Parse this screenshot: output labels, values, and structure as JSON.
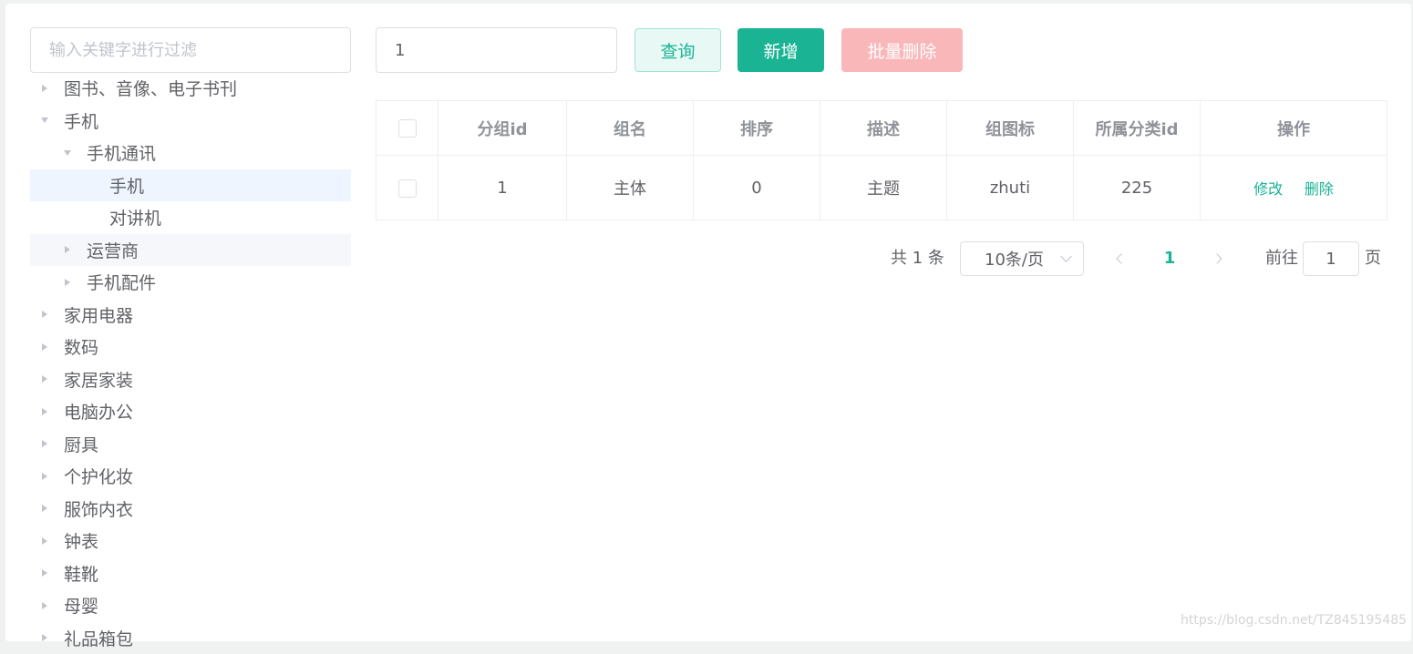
{
  "filter": {
    "placeholder": "输入关键字进行过滤"
  },
  "tree": [
    {
      "label": "图书、音像、电子书刊",
      "level": 0,
      "state": "collapsed"
    },
    {
      "label": "手机",
      "level": 0,
      "state": "expanded"
    },
    {
      "label": "手机通讯",
      "level": 1,
      "state": "expanded"
    },
    {
      "label": "手机",
      "level": 2,
      "state": "leaf",
      "selected": true
    },
    {
      "label": "对讲机",
      "level": 2,
      "state": "leaf"
    },
    {
      "label": "运营商",
      "level": 1,
      "state": "collapsed",
      "hover": true
    },
    {
      "label": "手机配件",
      "level": 1,
      "state": "collapsed"
    },
    {
      "label": "家用电器",
      "level": 0,
      "state": "collapsed"
    },
    {
      "label": "数码",
      "level": 0,
      "state": "collapsed"
    },
    {
      "label": "家居家装",
      "level": 0,
      "state": "collapsed"
    },
    {
      "label": "电脑办公",
      "level": 0,
      "state": "collapsed"
    },
    {
      "label": "厨具",
      "level": 0,
      "state": "collapsed"
    },
    {
      "label": "个护化妆",
      "level": 0,
      "state": "collapsed"
    },
    {
      "label": "服饰内衣",
      "level": 0,
      "state": "collapsed"
    },
    {
      "label": "钟表",
      "level": 0,
      "state": "collapsed"
    },
    {
      "label": "鞋靴",
      "level": 0,
      "state": "collapsed"
    },
    {
      "label": "母婴",
      "level": 0,
      "state": "collapsed"
    },
    {
      "label": "礼品箱包",
      "level": 0,
      "state": "collapsed"
    }
  ],
  "toolbar": {
    "query_value": "1",
    "query_label": "查询",
    "add_label": "新增",
    "batch_delete_label": "批量删除"
  },
  "table": {
    "headers": [
      "分组id",
      "组名",
      "排序",
      "描述",
      "组图标",
      "所属分类id",
      "操作"
    ],
    "rows": [
      {
        "cells": [
          "1",
          "主体",
          "0",
          "主题",
          "zhuti",
          "225"
        ],
        "edit_label": "修改",
        "delete_label": "删除"
      }
    ]
  },
  "pagination": {
    "total_text": "共 1 条",
    "page_size": "10条/页",
    "current_page": "1",
    "goto_label": "前往",
    "goto_value": "1",
    "page_suffix": "页"
  },
  "watermark": "https://blog.csdn.net/TZ845195485",
  "colors": {
    "primary": "#1ab394",
    "danger_disabled": "#f9b7b9",
    "selected_bg": "#eef5fe"
  }
}
